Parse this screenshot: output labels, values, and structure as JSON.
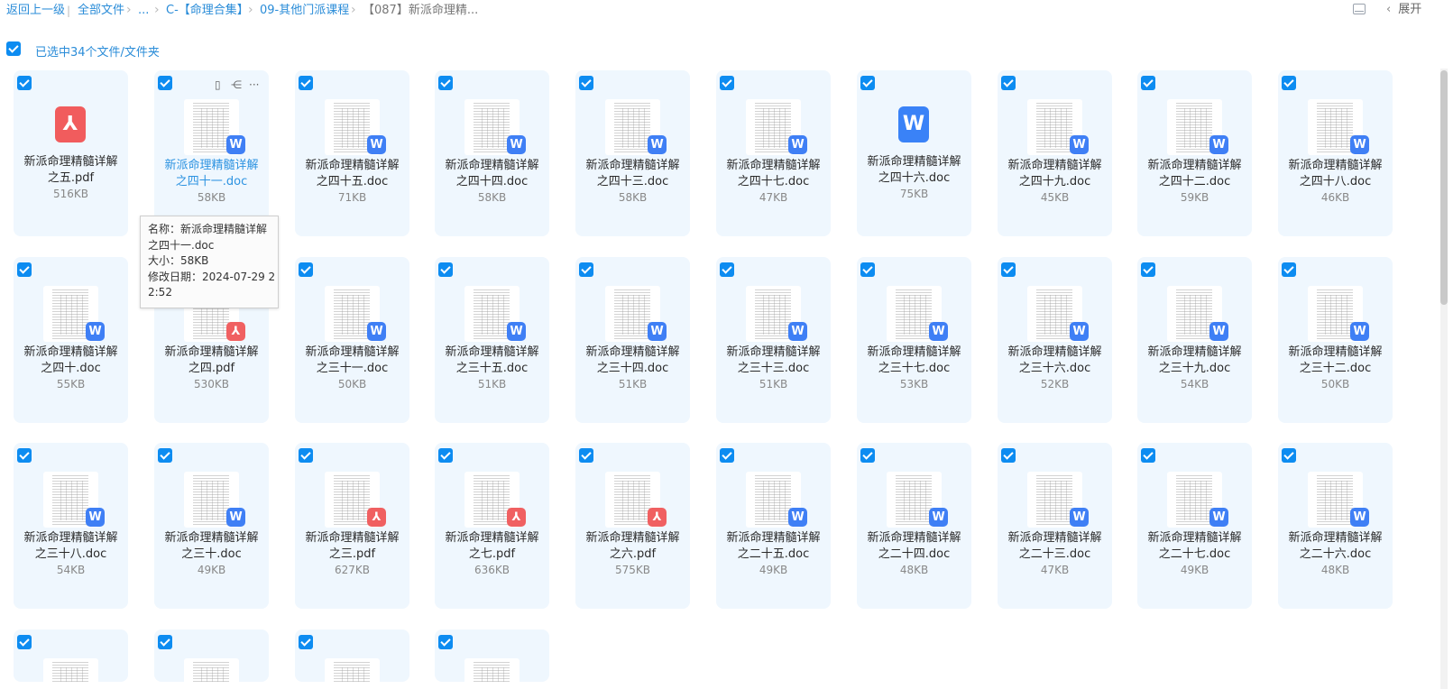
{
  "breadcrumb": {
    "back": "返回上一级",
    "all_files": "全部文件",
    "ellipsis": "...",
    "folder1": "C-【命理合集】",
    "folder2": "09-其他门派课程",
    "current": "【087】新派命理精..."
  },
  "toolbar": {
    "layout_icon": "layout-icon",
    "expand_label": "展开"
  },
  "selection": {
    "label": "已选中34个文件/文件夹"
  },
  "files": [
    {
      "line1": "新派命理精髓详解",
      "line2": "之五.pdf",
      "size": "516KB",
      "type": "pdf",
      "thumb": false
    },
    {
      "line1": "新派命理精髓详解",
      "line2": "之四十一.doc",
      "size": "58KB",
      "type": "doc",
      "thumb": true,
      "hover": true
    },
    {
      "line1": "新派命理精髓详解",
      "line2": "之四十五.doc",
      "size": "71KB",
      "type": "doc",
      "thumb": true
    },
    {
      "line1": "新派命理精髓详解",
      "line2": "之四十四.doc",
      "size": "58KB",
      "type": "doc",
      "thumb": true
    },
    {
      "line1": "新派命理精髓详解",
      "line2": "之四十三.doc",
      "size": "58KB",
      "type": "doc",
      "thumb": true
    },
    {
      "line1": "新派命理精髓详解",
      "line2": "之四十七.doc",
      "size": "47KB",
      "type": "doc",
      "thumb": true
    },
    {
      "line1": "新派命理精髓详解",
      "line2": "之四十六.doc",
      "size": "75KB",
      "type": "doc",
      "thumb": false
    },
    {
      "line1": "新派命理精髓详解",
      "line2": "之四十九.doc",
      "size": "45KB",
      "type": "doc",
      "thumb": true
    },
    {
      "line1": "新派命理精髓详解",
      "line2": "之四十二.doc",
      "size": "59KB",
      "type": "doc",
      "thumb": true
    },
    {
      "line1": "新派命理精髓详解",
      "line2": "之四十八.doc",
      "size": "46KB",
      "type": "doc",
      "thumb": true
    },
    {
      "line1": "新派命理精髓详解",
      "line2": "之四十.doc",
      "size": "55KB",
      "type": "doc",
      "thumb": true
    },
    {
      "line1": "新派命理精髓详解",
      "line2": "之四.pdf",
      "size": "530KB",
      "type": "pdf",
      "thumb": true
    },
    {
      "line1": "新派命理精髓详解",
      "line2": "之三十一.doc",
      "size": "50KB",
      "type": "doc",
      "thumb": true
    },
    {
      "line1": "新派命理精髓详解",
      "line2": "之三十五.doc",
      "size": "51KB",
      "type": "doc",
      "thumb": true
    },
    {
      "line1": "新派命理精髓详解",
      "line2": "之三十四.doc",
      "size": "51KB",
      "type": "doc",
      "thumb": true
    },
    {
      "line1": "新派命理精髓详解",
      "line2": "之三十三.doc",
      "size": "51KB",
      "type": "doc",
      "thumb": true
    },
    {
      "line1": "新派命理精髓详解",
      "line2": "之三十七.doc",
      "size": "53KB",
      "type": "doc",
      "thumb": true
    },
    {
      "line1": "新派命理精髓详解",
      "line2": "之三十六.doc",
      "size": "52KB",
      "type": "doc",
      "thumb": true
    },
    {
      "line1": "新派命理精髓详解",
      "line2": "之三十九.doc",
      "size": "54KB",
      "type": "doc",
      "thumb": true
    },
    {
      "line1": "新派命理精髓详解",
      "line2": "之三十二.doc",
      "size": "50KB",
      "type": "doc",
      "thumb": true
    },
    {
      "line1": "新派命理精髓详解",
      "line2": "之三十八.doc",
      "size": "54KB",
      "type": "doc",
      "thumb": true
    },
    {
      "line1": "新派命理精髓详解",
      "line2": "之三十.doc",
      "size": "49KB",
      "type": "doc",
      "thumb": true
    },
    {
      "line1": "新派命理精髓详解",
      "line2": "之三.pdf",
      "size": "627KB",
      "type": "pdf",
      "thumb": true
    },
    {
      "line1": "新派命理精髓详解",
      "line2": "之七.pdf",
      "size": "636KB",
      "type": "pdf",
      "thumb": true
    },
    {
      "line1": "新派命理精髓详解",
      "line2": "之六.pdf",
      "size": "575KB",
      "type": "pdf",
      "thumb": true
    },
    {
      "line1": "新派命理精髓详解",
      "line2": "之二十五.doc",
      "size": "49KB",
      "type": "doc",
      "thumb": true
    },
    {
      "line1": "新派命理精髓详解",
      "line2": "之二十四.doc",
      "size": "48KB",
      "type": "doc",
      "thumb": true
    },
    {
      "line1": "新派命理精髓详解",
      "line2": "之二十三.doc",
      "size": "47KB",
      "type": "doc",
      "thumb": true
    },
    {
      "line1": "新派命理精髓详解",
      "line2": "之二十七.doc",
      "size": "49KB",
      "type": "doc",
      "thumb": true
    },
    {
      "line1": "新派命理精髓详解",
      "line2": "之二十六.doc",
      "size": "48KB",
      "type": "doc",
      "thumb": true
    },
    {
      "line1": "",
      "line2": "",
      "size": "",
      "type": "doc",
      "thumb": true
    },
    {
      "line1": "",
      "line2": "",
      "size": "",
      "type": "doc",
      "thumb": true
    },
    {
      "line1": "",
      "line2": "",
      "size": "",
      "type": "doc",
      "thumb": true
    },
    {
      "line1": "",
      "line2": "",
      "size": "",
      "type": "doc",
      "thumb": true
    }
  ],
  "hover_actions": {
    "phone_icon": "phone-icon",
    "share_icon": "share-icon",
    "more_icon": "more-icon"
  },
  "tooltip": {
    "name_line1": "名称：新派命理精髓详解",
    "name_line2": "之四十一.doc",
    "size": "大小：58KB",
    "date_line1": "修改日期：2024-07-29 2",
    "date_line2": "2:52"
  },
  "colors": {
    "accent": "#0d8cf1",
    "link": "#2a8cd8",
    "card_bg": "#eff7fe",
    "doc_badge": "#3f7ff5",
    "pdf_badge": "#f06061"
  }
}
